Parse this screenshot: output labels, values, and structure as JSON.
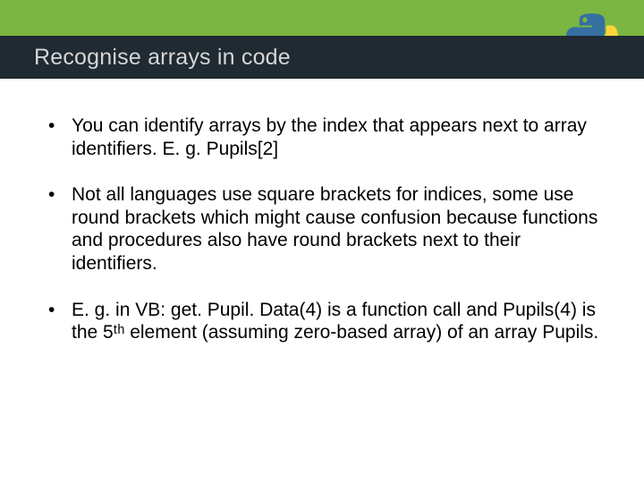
{
  "header": {
    "title": "Recognise arrays in code",
    "logo_name": "python-logo"
  },
  "bullets": [
    "You can identify arrays by the index that appears next to array identifiers. E. g. Pupils[2]",
    "Not all languages use square brackets for indices, some use round brackets which might cause confusion because functions and procedures also have round brackets next to their identifiers.",
    "E. g. in VB: get. Pupil. Data(4) is a function call and Pupils(4) is the 5ᵗʰ element (assuming zero-based array) of an array Pupils."
  ]
}
